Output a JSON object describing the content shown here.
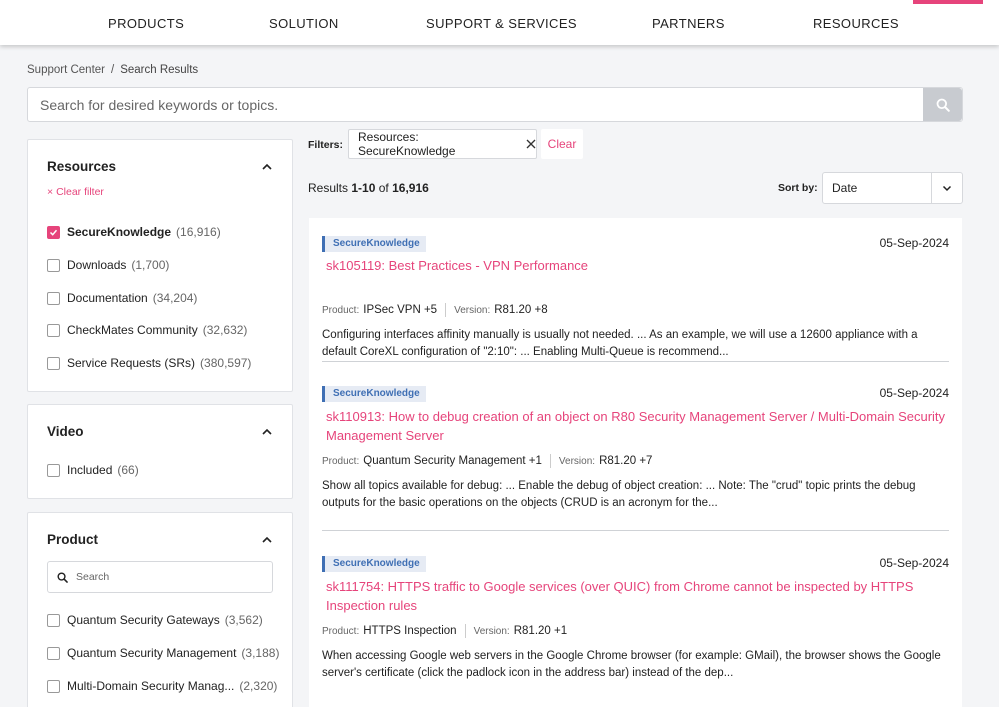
{
  "nav": {
    "items": [
      "PRODUCTS",
      "SOLUTION",
      "SUPPORT & SERVICES",
      "PARTNERS",
      "RESOURCES"
    ]
  },
  "breadcrumb": {
    "root": "Support Center",
    "separator": "/",
    "current": "Search Results"
  },
  "search": {
    "placeholder": "Search for desired keywords or topics.",
    "value": ""
  },
  "sidebar": {
    "resources": {
      "title": "Resources",
      "clear_filter": "Clear filter",
      "items": [
        {
          "label": "SecureKnowledge",
          "count": "(16,916)",
          "checked": true
        },
        {
          "label": "Downloads",
          "count": "(1,700)",
          "checked": false
        },
        {
          "label": "Documentation",
          "count": "(34,204)",
          "checked": false
        },
        {
          "label": "CheckMates Community",
          "count": "(32,632)",
          "checked": false
        },
        {
          "label": "Service Requests (SRs)",
          "count": "(380,597)",
          "checked": false
        }
      ]
    },
    "video": {
      "title": "Video",
      "items": [
        {
          "label": "Included",
          "count": "(66)",
          "checked": false
        }
      ]
    },
    "product": {
      "title": "Product",
      "search_placeholder": "Search",
      "items": [
        {
          "label": "Quantum Security Gateways",
          "count": "(3,562)",
          "checked": false
        },
        {
          "label": "Quantum Security Management",
          "count": "(3,188)",
          "checked": false
        },
        {
          "label": "Multi-Domain Security Manag...",
          "count": "(2,320)",
          "checked": false
        }
      ]
    }
  },
  "filters": {
    "label": "Filters:",
    "chip": "Resources: SecureKnowledge",
    "clear": "Clear"
  },
  "results_summary": {
    "prefix": "Results",
    "range": "1-10",
    "of": "of",
    "total": "16,916"
  },
  "sort": {
    "label": "Sort by:",
    "value": "Date"
  },
  "results": [
    {
      "badge": "SecureKnowledge",
      "date": "05-Sep-2024",
      "title": "sk105119: Best Practices - VPN Performance",
      "product_label": "Product:",
      "product": "IPSec VPN +5",
      "version_label": "Version:",
      "version": "R81.20 +8",
      "snippet": "Configuring interfaces affinity manually is usually not needed. ... As an example, we will use a 12600 appliance with a default CoreXL configuration of \"2:10\": ... Enabling Multi-Queue is recommend..."
    },
    {
      "badge": "SecureKnowledge",
      "date": "05-Sep-2024",
      "title": "sk110913: How to debug creation of an object on R80 Security Management Server / Multi-Domain Security Management Server",
      "product_label": "Product:",
      "product": "Quantum Security Management +1",
      "version_label": "Version:",
      "version": "R81.20 +7",
      "snippet": "Show all topics available for debug: ... Enable the debug of object creation: ... Note: The \"crud\" topic prints the debug outputs for the basic operations on the objects (CRUD is an acronym for the..."
    },
    {
      "badge": "SecureKnowledge",
      "date": "05-Sep-2024",
      "title": "sk111754: HTTPS traffic to Google services (over QUIC) from Chrome cannot be inspected by HTTPS Inspection rules",
      "product_label": "Product:",
      "product": "HTTPS Inspection",
      "version_label": "Version:",
      "version": "R81.20 +1",
      "snippet": "When accessing Google web servers in the Google Chrome browser (for example: GMail), the browser shows the Google server's certificate (click the padlock icon in the address bar) instead of the dep..."
    }
  ],
  "colors": {
    "accent": "#e6447b",
    "badge_text": "#3f6fb4",
    "badge_bg": "#e6ebf4",
    "background": "#f4f5f7"
  },
  "icons": {
    "search": "search-icon",
    "chevron": "chevron-up-icon",
    "remove": "close-icon",
    "dropdown": "chevron-down-icon",
    "check": "check-icon"
  }
}
